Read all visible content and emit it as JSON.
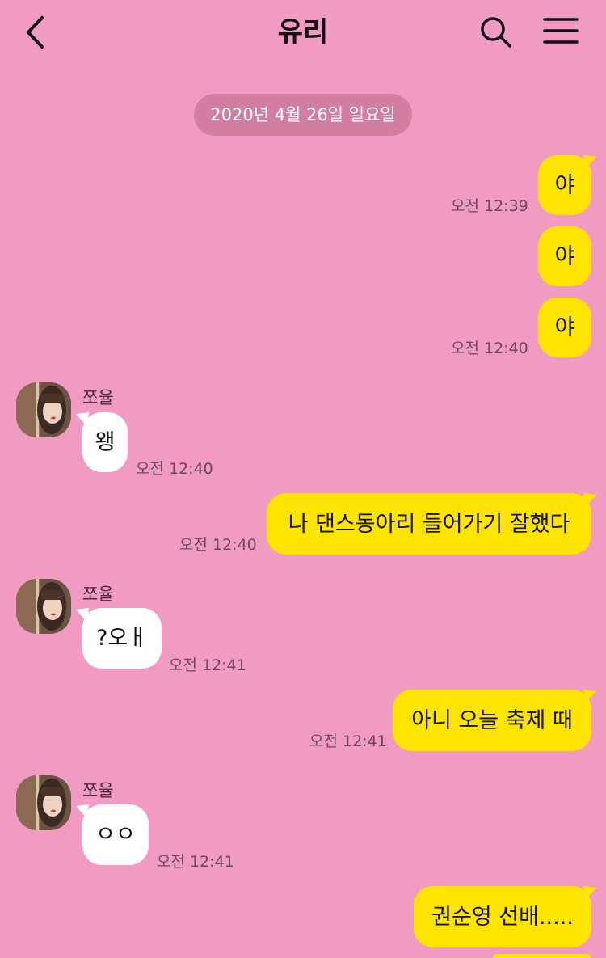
{
  "header": {
    "title": "유리",
    "icons": {
      "back": "back-chevron-icon",
      "search": "search-icon",
      "menu": "menu-icon"
    }
  },
  "chat": {
    "date": "2020년 4월 26일 일요일",
    "messages": [
      {
        "sender": "me",
        "text": "야",
        "time": "오전 12:39"
      },
      {
        "sender": "me",
        "text": "야",
        "time": ""
      },
      {
        "sender": "me",
        "text": "야",
        "time": "오전 12:40"
      },
      {
        "sender": "them",
        "name": "쪼율",
        "text": "왱",
        "time": "오전 12:40"
      },
      {
        "sender": "me",
        "text": "나 댄스동아리 들어가기 잘했다",
        "time": "오전 12:40"
      },
      {
        "sender": "them",
        "name": "쪼율",
        "text": "?오ㅐ",
        "time": "오전 12:41"
      },
      {
        "sender": "me",
        "text": "아니 오늘 축제 때",
        "time": "오전 12:41"
      },
      {
        "sender": "them",
        "name": "쪼율",
        "text": "ㅇㅇ",
        "time": "오전 12:41"
      },
      {
        "sender": "me",
        "text": "권순영 선배.....",
        "time": ""
      }
    ]
  },
  "colors": {
    "background": "#f29bc2",
    "my_bubble": "#ffe400",
    "their_bubble": "#ffffff",
    "date_pill": "#d27f9f"
  }
}
